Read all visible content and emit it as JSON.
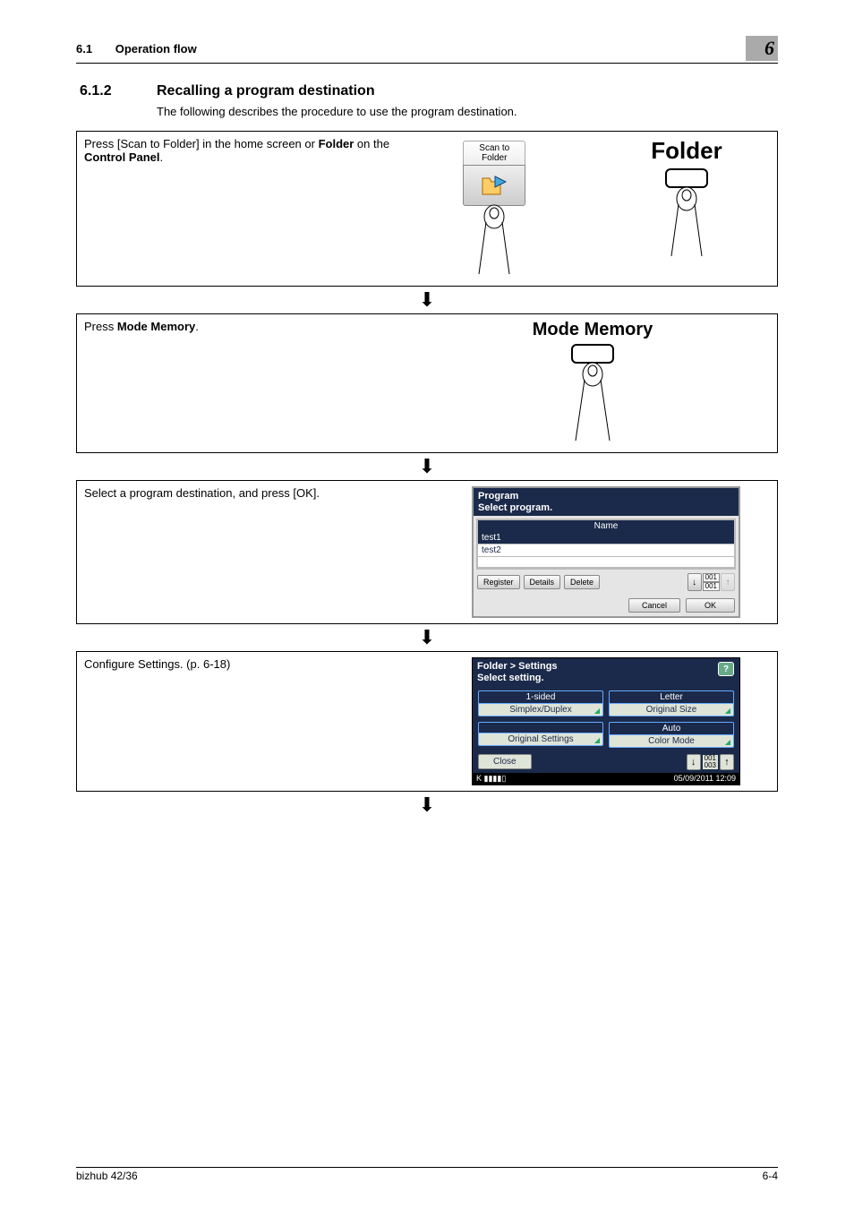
{
  "header": {
    "section_no": "6.1",
    "section_title": "Operation flow",
    "chapter": "6"
  },
  "heading": {
    "no": "6.1.2",
    "title": "Recalling a program destination"
  },
  "intro": "The following describes the procedure to use the program destination.",
  "step1": {
    "text_before": "Press [Scan to Folder] in the home screen or ",
    "bold1": "Folder",
    "mid": " on the ",
    "bold2": "Control Panel",
    "after": ".",
    "btn_line1": "Scan to",
    "btn_line2": "Folder",
    "folder_label": "Folder"
  },
  "step2": {
    "prefix": "Press ",
    "bold": "Mode Memory",
    "suffix": ".",
    "label": "Mode Memory"
  },
  "step3": {
    "text": "Select a program destination, and press [OK].",
    "hdr1": "Program",
    "hdr2": "Select program.",
    "name_hdr": "Name",
    "rows": [
      "test1",
      "test2"
    ],
    "register": "Register",
    "details": "Details",
    "delete": "Delete",
    "page_top": "001",
    "page_bot": "001",
    "cancel": "Cancel",
    "ok": "OK"
  },
  "step4": {
    "text": "Configure Settings. (p. 6-18)",
    "breadcrumb": "Folder > Settings",
    "subtitle": "Select setting.",
    "help": "?",
    "c1v": "1-sided",
    "c1l": "Simplex/Duplex",
    "c2v": "Letter",
    "c2l": "Original Size",
    "c3v": "",
    "c3l": "Original Settings",
    "c4v": "Auto",
    "c4l": "Color Mode",
    "close": "Close",
    "page_top": "001",
    "page_bot": "003",
    "toner": "K ▮▮▮▮▯",
    "date": "05/09/2011  12:09"
  },
  "footer": {
    "left": "bizhub 42/36",
    "right": "6-4"
  }
}
